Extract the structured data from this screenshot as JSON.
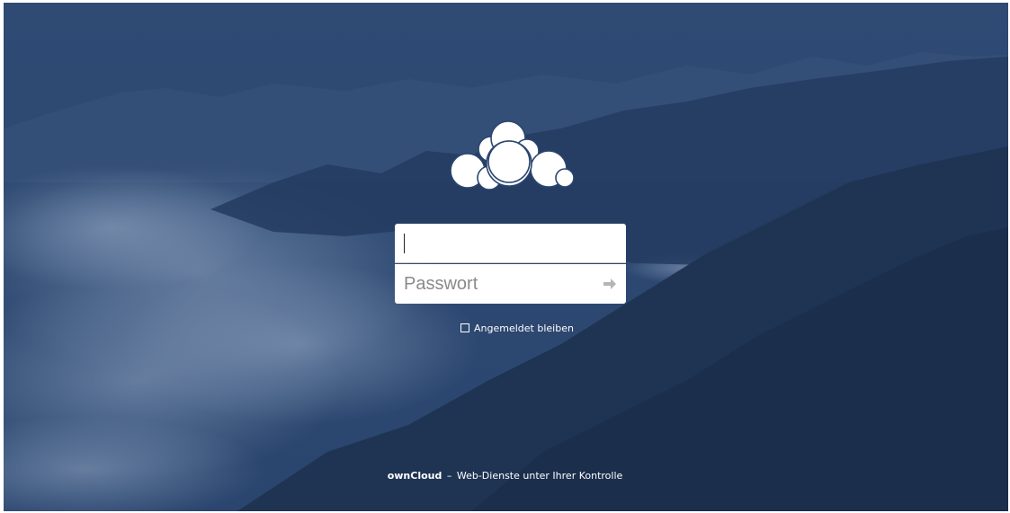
{
  "login": {
    "username": {
      "value": "",
      "placeholder": ""
    },
    "password": {
      "value": "",
      "placeholder": "Passwort"
    },
    "submit_icon": "arrow-right-icon"
  },
  "remember": {
    "label": "Angemeldet bleiben",
    "checked": false
  },
  "footer": {
    "brand": "ownCloud",
    "separator": "–",
    "tagline": "Web-Dienste unter Ihrer Kontrolle"
  },
  "logo": {
    "icon": "owncloud-cloud-icon",
    "color": "#ffffff"
  },
  "colors": {
    "background": "#2b4670",
    "mountains_dark": "#1f3352",
    "clouds": "#8aa0bf",
    "input_bg": "#ffffff",
    "text_on_bg": "#ffffff"
  }
}
